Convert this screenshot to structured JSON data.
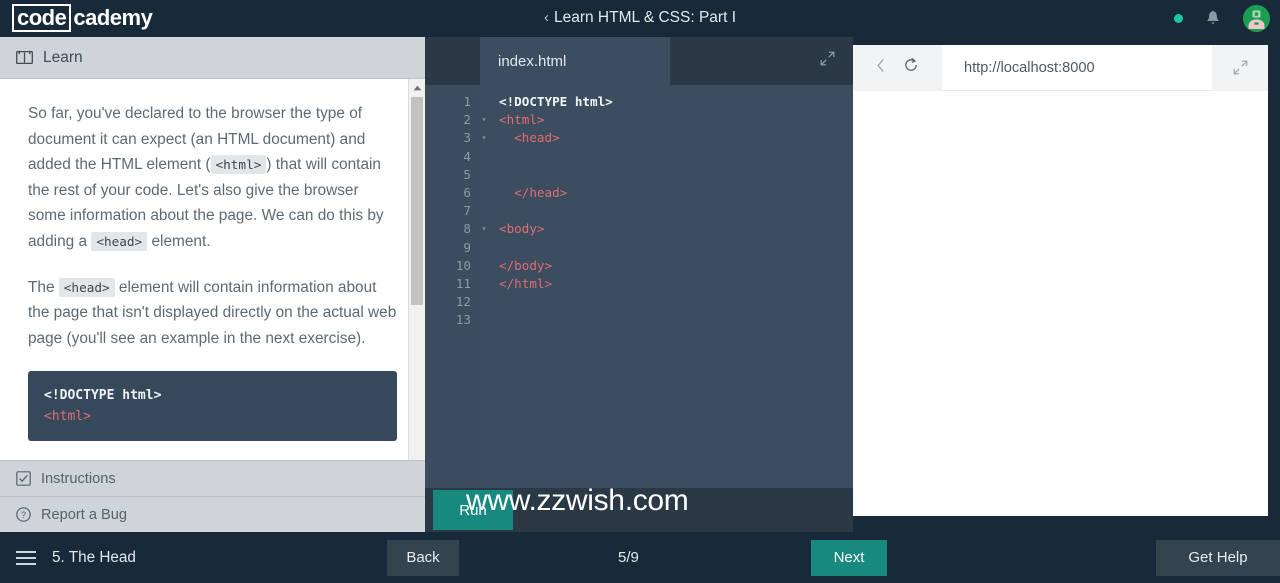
{
  "brand": {
    "logo_boxed": "code",
    "logo_tail": "cademy"
  },
  "header": {
    "back_chevron": "‹",
    "course_title": "Learn HTML & CSS: Part I",
    "status_dot_icon": "online-dot-icon",
    "bell_icon": "notification-bell-icon",
    "avatar_icon": "user-avatar-icon",
    "accent_green": "#19c9a3",
    "avatar_bg": "#1c9e52"
  },
  "learn_panel": {
    "tab_label": "Learn",
    "book_icon": "book-icon",
    "paragraphs": [
      {
        "parts": [
          {
            "type": "text",
            "value": "So far, you've declared to the browser the type of document it can expect (an HTML document) and added the HTML element ("
          },
          {
            "type": "code",
            "value": "<html>"
          },
          {
            "type": "text",
            "value": ") that will contain the rest of your code. Let's also give the browser some information about the page. We can do this by adding a "
          },
          {
            "type": "code",
            "value": "<head>"
          },
          {
            "type": "text",
            "value": " element."
          }
        ]
      },
      {
        "parts": [
          {
            "type": "text",
            "value": "The "
          },
          {
            "type": "code",
            "value": "<head>"
          },
          {
            "type": "text",
            "value": " element will contain information about the page that isn't displayed directly on the actual web page (you'll see an example in the next exercise)."
          }
        ]
      }
    ],
    "code_block": [
      {
        "text": "<!DOCTYPE html>",
        "token": "white"
      },
      {
        "text": "<html>",
        "token": "red"
      }
    ],
    "bottom_tabs": [
      {
        "label": "Instructions",
        "icon": "checkbox-icon"
      },
      {
        "label": "Report a Bug",
        "icon": "question-circle-icon"
      }
    ],
    "scrollbar_icon": "scroll-up-arrow-icon"
  },
  "editor": {
    "tab_label": "index.html",
    "expand_icon": "expand-icon",
    "run_label": "Run",
    "lines": [
      {
        "num": "1",
        "fold": "",
        "indent": 0,
        "tokens": [
          {
            "t": "<!DOCTYPE html>",
            "c": "white"
          }
        ]
      },
      {
        "num": "2",
        "fold": "▾",
        "indent": 0,
        "tokens": [
          {
            "t": "<html>",
            "c": "red"
          }
        ]
      },
      {
        "num": "3",
        "fold": "▾",
        "indent": 1,
        "tokens": [
          {
            "t": "<head>",
            "c": "red"
          }
        ]
      },
      {
        "num": "4",
        "fold": "",
        "indent": 0,
        "tokens": []
      },
      {
        "num": "5",
        "fold": "",
        "indent": 0,
        "tokens": []
      },
      {
        "num": "6",
        "fold": "",
        "indent": 1,
        "tokens": [
          {
            "t": "</head>",
            "c": "red"
          }
        ]
      },
      {
        "num": "7",
        "fold": "",
        "indent": 0,
        "tokens": []
      },
      {
        "num": "8",
        "fold": "▾",
        "indent": 0,
        "tokens": [
          {
            "t": "<body>",
            "c": "red"
          }
        ]
      },
      {
        "num": "9",
        "fold": "",
        "indent": 0,
        "tokens": []
      },
      {
        "num": "10",
        "fold": "",
        "indent": 0,
        "tokens": [
          {
            "t": "</body>",
            "c": "red"
          }
        ]
      },
      {
        "num": "11",
        "fold": "",
        "indent": 0,
        "tokens": [
          {
            "t": "</html>",
            "c": "red"
          }
        ]
      },
      {
        "num": "12",
        "fold": "",
        "indent": 0,
        "tokens": []
      },
      {
        "num": "13",
        "fold": "",
        "indent": 0,
        "tokens": []
      }
    ]
  },
  "preview": {
    "back_icon": "back-chevron-icon",
    "reload_icon": "reload-icon",
    "url": "http://localhost:8000",
    "expand_icon": "expand-icon",
    "page_content": ""
  },
  "bottom_bar": {
    "menu_icon": "hamburger-menu-icon",
    "lesson_title": "5. The Head",
    "back_label": "Back",
    "progress": "5/9",
    "next_label": "Next",
    "help_label": "Get Help",
    "next_color": "#17897e"
  },
  "watermark": {
    "text": "www.zzwish.com"
  }
}
